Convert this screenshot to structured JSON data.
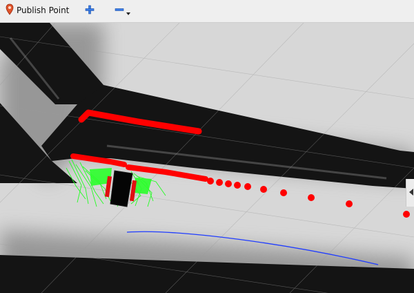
{
  "toolbar": {
    "publish_point_label": "Publish Point",
    "publish_point_icon": "map-pin-icon",
    "add_icon": "plus-icon",
    "remove_icon": "minus-icon",
    "dropdown_icon": "caret-down-icon"
  },
  "colors": {
    "obstacle_marker": "#ff0000",
    "global_path": "#1f3cff",
    "local_trajectories": "#00ff00",
    "robot_body": "#000000",
    "map_free": "#d6d6d6",
    "map_occupied": "#141414"
  },
  "viewport": {
    "grid_visible": true,
    "collapse_handle_icon": "triangle-left-icon"
  }
}
